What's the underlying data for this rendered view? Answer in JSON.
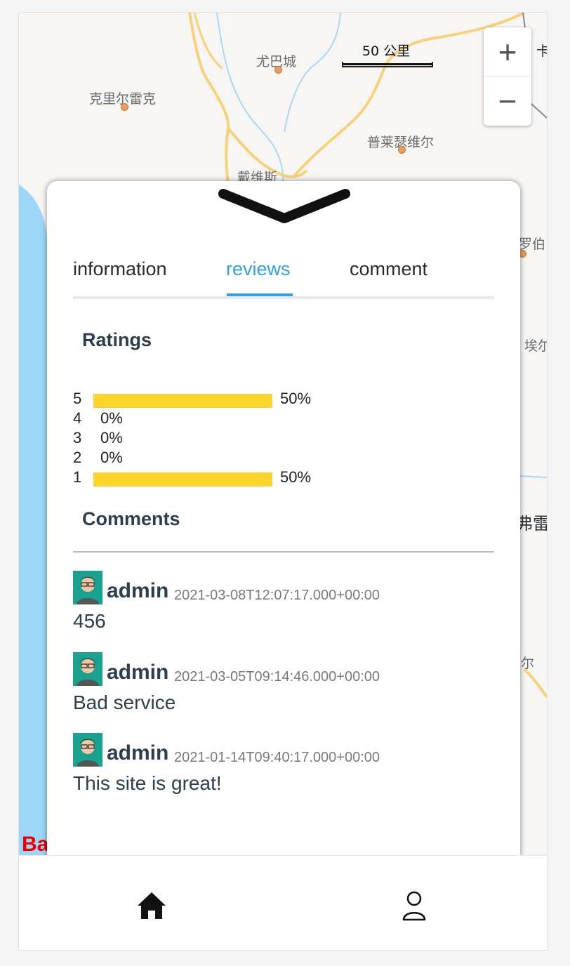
{
  "map": {
    "cities": [
      "克里尔雷克",
      "尤巴城",
      "普莱瑟维尔",
      "戴维斯",
      "罗伯",
      "埃尔",
      "弗雷",
      "尔",
      "卡"
    ],
    "scale_label": "50 公里",
    "zoom_in": "+",
    "zoom_out": "−",
    "logo_text": "Ba"
  },
  "tabs": [
    {
      "label": "information",
      "active": false
    },
    {
      "label": "reviews",
      "active": true
    },
    {
      "label": "comment",
      "active": false
    }
  ],
  "ratings": {
    "title": "Ratings",
    "rows": [
      {
        "star": "5",
        "percent": "50%",
        "fraction": 0.5
      },
      {
        "star": "4",
        "percent": "0%",
        "fraction": 0
      },
      {
        "star": "3",
        "percent": "0%",
        "fraction": 0
      },
      {
        "star": "2",
        "percent": "0%",
        "fraction": 0
      },
      {
        "star": "1",
        "percent": "50%",
        "fraction": 0.5
      }
    ],
    "bar_color": "#fdd42c"
  },
  "comments": {
    "title": "Comments",
    "items": [
      {
        "author": "admin",
        "time": "2021-03-08T12:07:17.000+00:00",
        "text": "456"
      },
      {
        "author": "admin",
        "time": "2021-03-05T09:14:46.000+00:00",
        "text": "Bad service"
      },
      {
        "author": "admin",
        "time": "2021-01-14T09:40:17.000+00:00",
        "text": "This site is great!"
      }
    ]
  },
  "colors": {
    "accent": "#2ea1ef",
    "heading": "#2c3e50"
  },
  "bottom_nav": {
    "home_icon": "home-icon",
    "user_icon": "user-icon"
  }
}
